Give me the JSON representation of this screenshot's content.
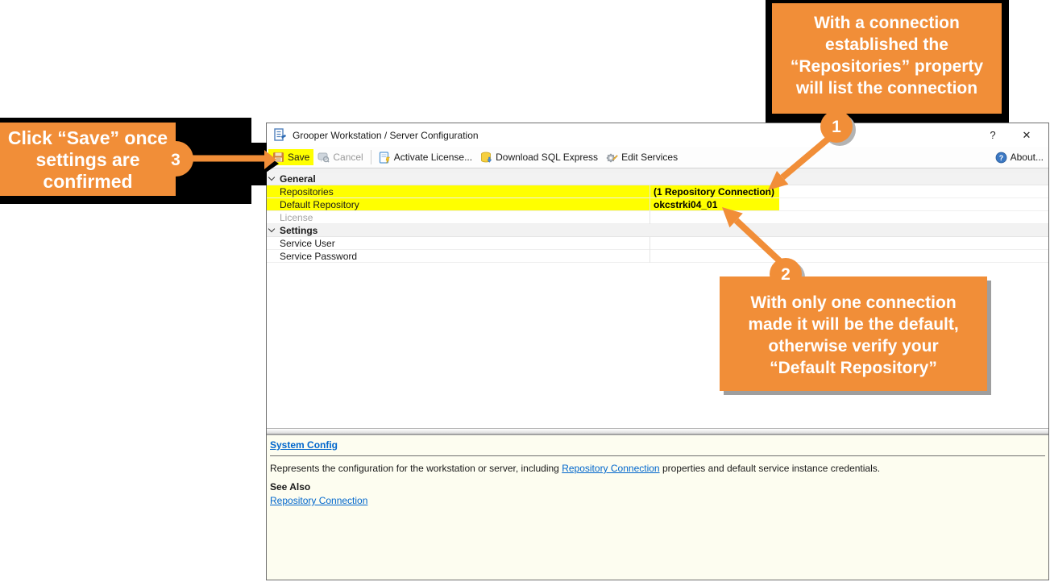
{
  "colors": {
    "accent_orange": "#F18E38",
    "highlight_yellow": "#FFFF00",
    "link_blue": "#0066CC",
    "help_bg": "#FDFDF0"
  },
  "window": {
    "title": "Grooper Workstation / Server Configuration",
    "help_glyph": "?",
    "close_glyph": "✕",
    "toolbar": {
      "save": "Save",
      "cancel": "Cancel",
      "activate_license": "Activate License...",
      "download_sql": "Download SQL Express",
      "edit_services": "Edit Services",
      "about": "About..."
    },
    "grid": {
      "rows": [
        {
          "label": "General",
          "value": ""
        },
        {
          "label": "Repositories",
          "value": "(1 Repository Connection)"
        },
        {
          "label": "Default Repository",
          "value": "okcstrki04_01"
        },
        {
          "label": "License",
          "value": ""
        },
        {
          "label": "Settings",
          "value": ""
        },
        {
          "label": "Service User",
          "value": ""
        },
        {
          "label": "Service Password",
          "value": ""
        }
      ]
    },
    "help_panel": {
      "title": "System Config",
      "body_prefix": "Represents the configuration for the workstation or server, including ",
      "body_link": "Repository Connection",
      "body_suffix": " properties and default service instance credentials.",
      "see_also": "See Also",
      "see_also_link": "Repository Connection"
    }
  },
  "callouts": {
    "one": {
      "number": "1",
      "lines": [
        "With a connection",
        "established the",
        "“Repositories” property",
        "will list the connection"
      ]
    },
    "two": {
      "number": "2",
      "lines": [
        "With only one connection",
        "made it will be the default,",
        "otherwise verify your",
        "“Default Repository”"
      ]
    },
    "three": {
      "number": "3",
      "lines": [
        "Click “Save” once",
        "settings are",
        "confirmed"
      ]
    }
  }
}
